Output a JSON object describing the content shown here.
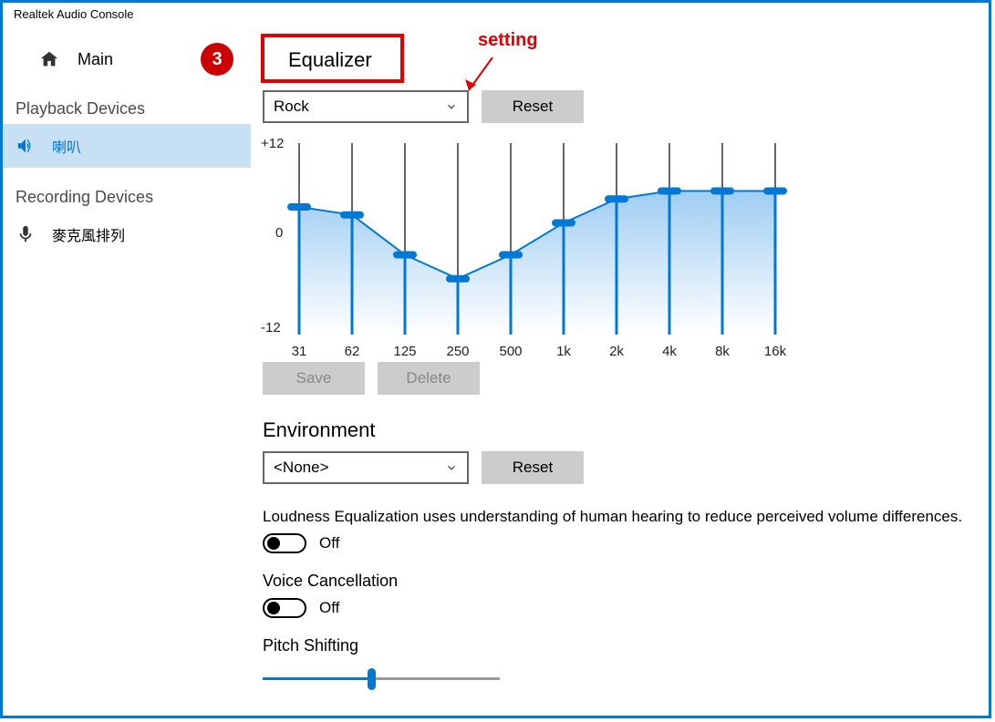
{
  "title": "Realtek Audio Console",
  "sidebar": {
    "main": "Main",
    "playback_header": "Playback Devices",
    "playback_item": "喇叭",
    "recording_header": "Recording Devices",
    "recording_item": "麥克風排列"
  },
  "annot": {
    "badge": "3",
    "label": "setting"
  },
  "eq": {
    "title": "Equalizer",
    "preset": "Rock",
    "reset": "Reset",
    "save": "Save",
    "delete": "Delete",
    "y_top": "+12",
    "y_mid": "0",
    "y_bot": "-12"
  },
  "env": {
    "title": "Environment",
    "value": "<None>",
    "reset": "Reset"
  },
  "loudness": {
    "desc": "Loudness Equalization uses understanding of human hearing to reduce perceived volume differences.",
    "state_label": "Off"
  },
  "voice": {
    "title": "Voice Cancellation",
    "state_label": "Off"
  },
  "pitch": {
    "title": "Pitch Shifting"
  },
  "chart_data": {
    "type": "line",
    "title": "Equalizer",
    "xlabel": "",
    "ylabel": "",
    "ylim": [
      -12,
      12
    ],
    "categories": [
      "31",
      "62",
      "125",
      "250",
      "500",
      "1k",
      "2k",
      "4k",
      "8k",
      "16k"
    ],
    "values": [
      4,
      3,
      -2,
      -5,
      -2,
      2,
      5,
      6,
      6,
      6
    ]
  }
}
